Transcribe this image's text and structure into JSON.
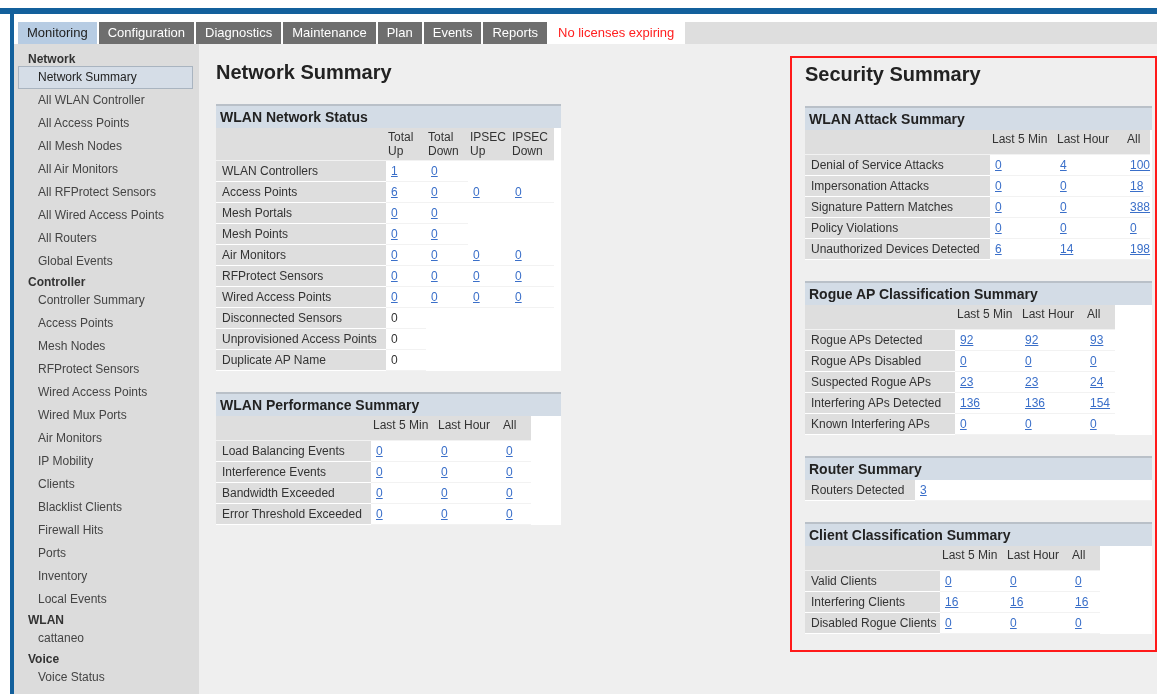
{
  "tabs": [
    {
      "label": "Monitoring",
      "selected": true,
      "kind": "tab"
    },
    {
      "label": "Configuration",
      "selected": false,
      "kind": "tab"
    },
    {
      "label": "Diagnostics",
      "selected": false,
      "kind": "tab"
    },
    {
      "label": "Maintenance",
      "selected": false,
      "kind": "tab"
    },
    {
      "label": "Plan",
      "selected": false,
      "kind": "tab"
    },
    {
      "label": "Events",
      "selected": false,
      "kind": "tab"
    },
    {
      "label": "Reports",
      "selected": false,
      "kind": "tab"
    },
    {
      "label": "No licenses expiring",
      "kind": "alert"
    }
  ],
  "sidebar": {
    "groups": [
      {
        "heading": "Network",
        "items": [
          {
            "label": "Network Summary",
            "selected": true
          },
          {
            "label": "All WLAN Controller",
            "selected": false
          },
          {
            "label": "All Access Points",
            "selected": false
          },
          {
            "label": "All Mesh Nodes",
            "selected": false
          },
          {
            "label": "All Air Monitors",
            "selected": false
          },
          {
            "label": "All RFProtect Sensors",
            "selected": false
          },
          {
            "label": "All Wired Access Points",
            "selected": false
          },
          {
            "label": "All Routers",
            "selected": false
          },
          {
            "label": "Global Events",
            "selected": false
          }
        ]
      },
      {
        "heading": "Controller",
        "items": [
          {
            "label": "Controller Summary",
            "selected": false
          },
          {
            "label": "Access Points",
            "selected": false
          },
          {
            "label": "Mesh Nodes",
            "selected": false
          },
          {
            "label": "RFProtect Sensors",
            "selected": false
          },
          {
            "label": "Wired Access Points",
            "selected": false
          },
          {
            "label": "Wired Mux Ports",
            "selected": false
          },
          {
            "label": "Air Monitors",
            "selected": false
          },
          {
            "label": "IP Mobility",
            "selected": false
          },
          {
            "label": "Clients",
            "selected": false
          },
          {
            "label": "Blacklist Clients",
            "selected": false
          },
          {
            "label": "Firewall Hits",
            "selected": false
          },
          {
            "label": "Ports",
            "selected": false
          },
          {
            "label": "Inventory",
            "selected": false
          },
          {
            "label": "Local Events",
            "selected": false
          }
        ]
      },
      {
        "heading": "WLAN",
        "items": [
          {
            "label": "cattaneo",
            "selected": false
          }
        ]
      },
      {
        "heading": "Voice",
        "items": [
          {
            "label": "Voice Status",
            "selected": false
          }
        ]
      }
    ]
  },
  "network": {
    "title": "Network Summary",
    "tables": [
      {
        "title": "WLAN Network Status",
        "columns": [
          "Total Up",
          "Total Down",
          "IPSEC Up",
          "IPSEC Down"
        ],
        "rows": [
          {
            "label": "WLAN Controllers",
            "linked": true,
            "cells": [
              "1",
              "0"
            ]
          },
          {
            "label": "Access Points",
            "linked": true,
            "cells": [
              "6",
              "0",
              "0",
              "0"
            ]
          },
          {
            "label": "Mesh Portals",
            "linked": true,
            "cells": [
              "0",
              "0"
            ]
          },
          {
            "label": "Mesh Points",
            "linked": true,
            "cells": [
              "0",
              "0"
            ]
          },
          {
            "label": "Air Monitors",
            "linked": true,
            "cells": [
              "0",
              "0",
              "0",
              "0"
            ]
          },
          {
            "label": "RFProtect Sensors",
            "linked": true,
            "cells": [
              "0",
              "0",
              "0",
              "0"
            ]
          },
          {
            "label": "Wired Access Points",
            "linked": true,
            "cells": [
              "0",
              "0",
              "0",
              "0"
            ]
          },
          {
            "label": "Disconnected Sensors",
            "linked": false,
            "cells": [
              "0"
            ]
          },
          {
            "label": "Unprovisioned Access Points",
            "linked": false,
            "cells": [
              "0"
            ]
          },
          {
            "label": "Duplicate AP Name",
            "linked": false,
            "cells": [
              "0"
            ]
          }
        ]
      },
      {
        "title": "WLAN Performance Summary",
        "columns": [
          "Last 5 Min",
          "Last Hour",
          "All"
        ],
        "rows": [
          {
            "label": "Load Balancing Events",
            "linked": true,
            "cells": [
              "0",
              "0",
              "0"
            ]
          },
          {
            "label": "Interference Events",
            "linked": true,
            "cells": [
              "0",
              "0",
              "0"
            ]
          },
          {
            "label": "Bandwidth Exceeded",
            "linked": true,
            "cells": [
              "0",
              "0",
              "0"
            ]
          },
          {
            "label": "Error Threshold Exceeded",
            "linked": true,
            "cells": [
              "0",
              "0",
              "0"
            ]
          }
        ]
      }
    ]
  },
  "security": {
    "title": "Security Summary",
    "tables": [
      {
        "title": "WLAN Attack Summary",
        "columns": [
          "Last 5 Min",
          "Last Hour",
          "All"
        ],
        "rows": [
          {
            "label": "Denial of Service Attacks",
            "linked": true,
            "cells": [
              "0",
              "4",
              "100"
            ]
          },
          {
            "label": "Impersonation Attacks",
            "linked": true,
            "cells": [
              "0",
              "0",
              "18"
            ]
          },
          {
            "label": "Signature Pattern Matches",
            "linked": true,
            "cells": [
              "0",
              "0",
              "388"
            ]
          },
          {
            "label": "Policy Violations",
            "linked": true,
            "cells": [
              "0",
              "0",
              "0"
            ]
          },
          {
            "label": "Unauthorized Devices Detected",
            "linked": true,
            "cells": [
              "6",
              "14",
              "198"
            ]
          }
        ]
      },
      {
        "title": "Rogue AP Classification Summary",
        "columns": [
          "Last 5 Min",
          "Last Hour",
          "All"
        ],
        "rows": [
          {
            "label": "Rogue APs Detected",
            "linked": true,
            "cells": [
              "92",
              "92",
              "93"
            ]
          },
          {
            "label": "Rogue APs Disabled",
            "linked": true,
            "cells": [
              "0",
              "0",
              "0"
            ]
          },
          {
            "label": "Suspected Rogue APs",
            "linked": true,
            "cells": [
              "23",
              "23",
              "24"
            ]
          },
          {
            "label": "Interfering APs Detected",
            "linked": true,
            "cells": [
              "136",
              "136",
              "154"
            ]
          },
          {
            "label": "Known Interfering APs",
            "linked": true,
            "cells": [
              "0",
              "0",
              "0"
            ]
          }
        ]
      },
      {
        "title": "Router Summary",
        "rows": [
          {
            "label": "Routers Detected",
            "linked": true,
            "cells": [
              "3"
            ]
          }
        ]
      },
      {
        "title": "Client Classification Summary",
        "columns": [
          "Last 5 Min",
          "Last Hour",
          "All"
        ],
        "rows": [
          {
            "label": "Valid Clients",
            "linked": true,
            "cells": [
              "0",
              "0",
              "0"
            ]
          },
          {
            "label": "Interfering Clients",
            "linked": true,
            "cells": [
              "16",
              "16",
              "16"
            ]
          },
          {
            "label": "Disabled Rogue Clients",
            "linked": true,
            "cells": [
              "0",
              "0",
              "0"
            ]
          }
        ]
      }
    ]
  }
}
